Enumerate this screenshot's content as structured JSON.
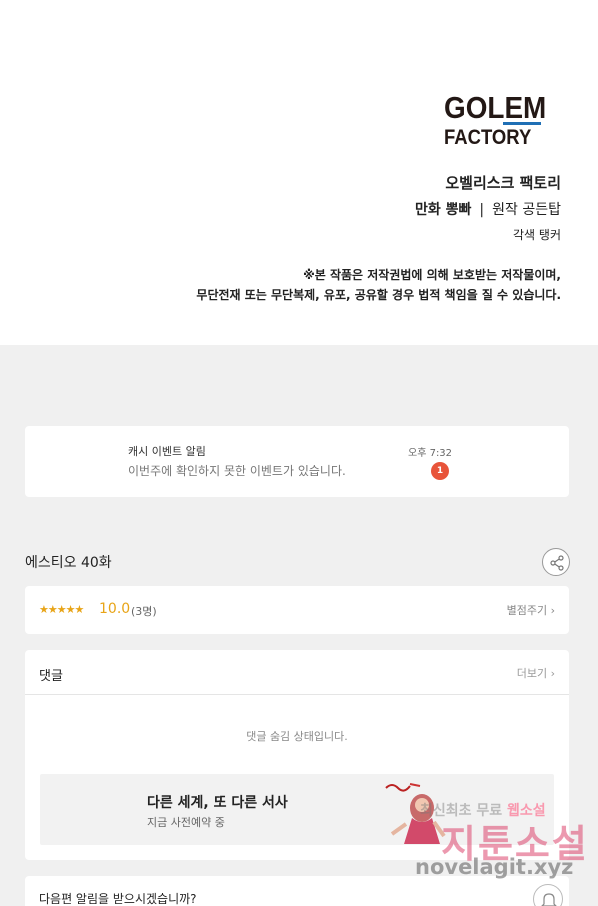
{
  "logo": {
    "line1": "GOLEM",
    "line2": "FACTORY"
  },
  "credits": {
    "title": "오벨리스크 팩토리",
    "art_label": "만화 뽕빠",
    "separator": "|",
    "original": "원작 공든탑",
    "adaptation": "각색 탱커"
  },
  "notice": {
    "line1": "※본 작품은 저작권법에 의해 보호받는 저작물이며,",
    "line2": "무단전재 또는 무단복제, 유포, 공유할 경우 법적 책임을 질 수 있습니다."
  },
  "event": {
    "title": "캐시 이벤트 알림",
    "message": "이번주에 확인하지 못한 이벤트가 있습니다.",
    "time": "오후 7:32",
    "badge": "1",
    "badge_color": "#e8543a"
  },
  "episode": {
    "title": "에스티오 40화",
    "share_icon": "share-icon"
  },
  "rating": {
    "stars": "★★★★★",
    "score": "10.0",
    "count": "(3명)",
    "give_label": "별점주기 ›",
    "accent": "#e8a417"
  },
  "comments": {
    "label": "댓글",
    "more": "더보기 ›",
    "hidden_message": "댓글 숨김 상태입니다."
  },
  "promo": {
    "title": "다른 세계, 또 다른 서사",
    "subtitle": "지금 사전예약 중"
  },
  "next": {
    "question": "다음편 알림을 받으시겠습니까?",
    "bell_icon": "bell-icon"
  },
  "watermark": {
    "line1_a": "최신최초 무료 ",
    "line1_b": "웹소설",
    "line2": "지툰소설",
    "line3": "novelagit.xyz"
  }
}
